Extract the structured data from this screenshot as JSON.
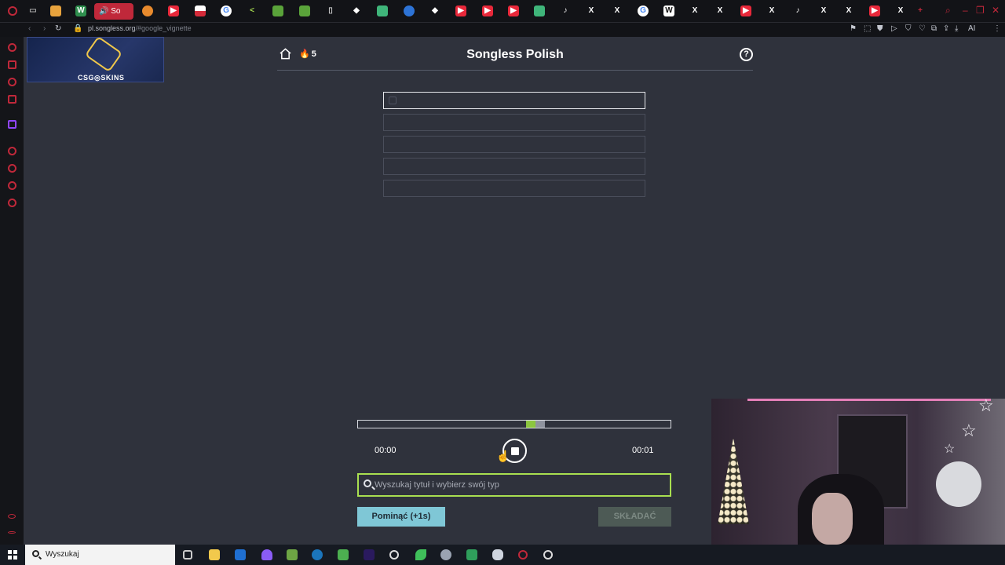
{
  "browser": {
    "active_tab_label": "So",
    "url_main": "pl.songless.org",
    "url_hash": "/#google_vignette",
    "tab_icons": [
      "google-icon",
      "x-icon",
      "youtube-icon",
      "tiktok-icon",
      "wikipedia-icon"
    ]
  },
  "ad": {
    "brand": "CSG◎SKINS"
  },
  "game": {
    "streak": "5",
    "title": "Songless Polish",
    "help_symbol": "?",
    "guess_slots": 5,
    "progress": {
      "played_fraction": 0.03,
      "total_segments": 1
    },
    "time_current": "00:00",
    "time_total": "00:01",
    "search_placeholder": "Wyszukaj tytuł i wybierz swój typ",
    "skip_label": "Pominąć (+1s)",
    "submit_label": "SKŁADAĆ"
  },
  "taskbar": {
    "search_label": "Wyszukaj"
  },
  "colors": {
    "accent_green": "#8cc63f",
    "skip_button": "#7fc7d6",
    "browser_accent": "#c0283a",
    "page_bg": "#2f323c"
  }
}
